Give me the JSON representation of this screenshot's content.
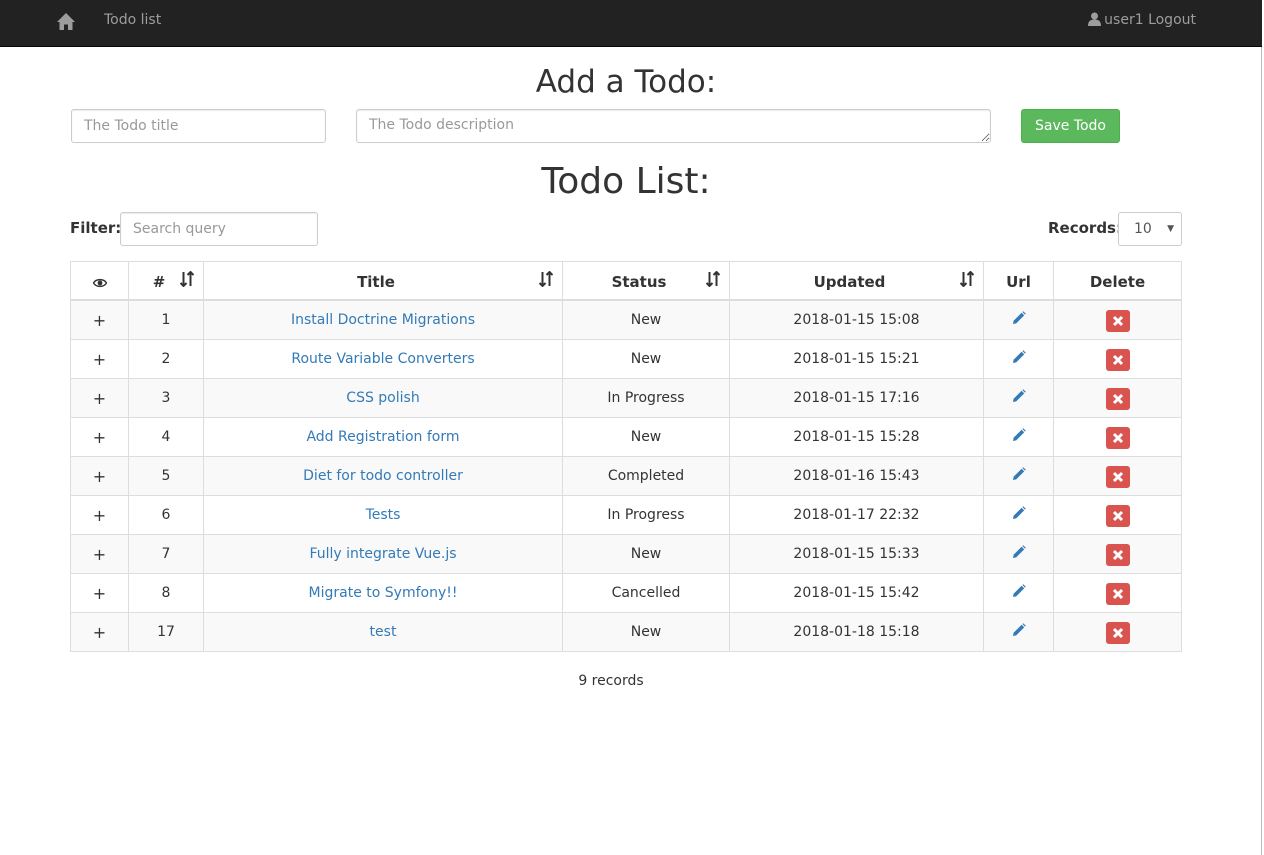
{
  "nav": {
    "brand": "Todo list",
    "user_label": "user1 Logout"
  },
  "add_form": {
    "heading": "Add a Todo:",
    "title_placeholder": "The Todo title",
    "description_placeholder": "The Todo description",
    "save_label": "Save Todo"
  },
  "list": {
    "heading": "Todo List:",
    "filter_label": "Filter:",
    "search_placeholder": "Search query",
    "records_label": "Records:",
    "records_value": "10",
    "columns": {
      "visible": "eye-icon",
      "num": "#",
      "title": "Title",
      "status": "Status",
      "updated": "Updated",
      "url": "Url",
      "delete": "Delete"
    },
    "rows": [
      {
        "expand": "+",
        "num": "1",
        "title": "Install Doctrine Migrations",
        "status": "New",
        "updated": "2018-01-15 15:08"
      },
      {
        "expand": "+",
        "num": "2",
        "title": "Route Variable Converters",
        "status": "New",
        "updated": "2018-01-15 15:21"
      },
      {
        "expand": "+",
        "num": "3",
        "title": "CSS polish",
        "status": "In Progress",
        "updated": "2018-01-15 17:16"
      },
      {
        "expand": "+",
        "num": "4",
        "title": "Add Registration form",
        "status": "New",
        "updated": "2018-01-15 15:28"
      },
      {
        "expand": "+",
        "num": "5",
        "title": "Diet for todo controller",
        "status": "Completed",
        "updated": "2018-01-16 15:43"
      },
      {
        "expand": "+",
        "num": "6",
        "title": "Tests",
        "status": "In Progress",
        "updated": "2018-01-17 22:32"
      },
      {
        "expand": "+",
        "num": "7",
        "title": "Fully integrate Vue.js",
        "status": "New",
        "updated": "2018-01-15 15:33"
      },
      {
        "expand": "+",
        "num": "8",
        "title": "Migrate to Symfony!!",
        "status": "Cancelled",
        "updated": "2018-01-15 15:42"
      },
      {
        "expand": "+",
        "num": "17",
        "title": "test",
        "status": "New",
        "updated": "2018-01-18 15:18"
      }
    ],
    "footer": "9 records"
  },
  "colors": {
    "navbar": "#222222",
    "link": "#337ab7",
    "save_button": "#5cb85c",
    "delete_button": "#d9534f"
  }
}
